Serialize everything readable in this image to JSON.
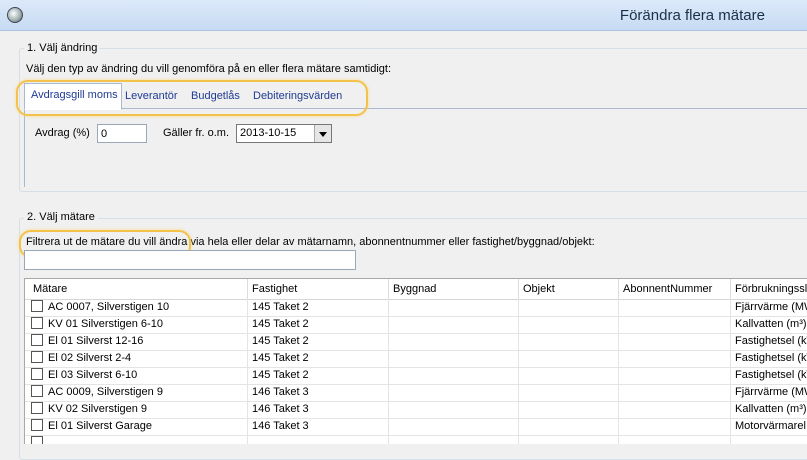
{
  "window": {
    "title": "Förändra flera mätare"
  },
  "section1": {
    "label": "1. Välj ändring",
    "hint": "Välj den typ av ändring du vill genomföra på en eller flera mätare samtidigt:",
    "tabs": [
      "Avdragsgill moms",
      "Leverantör",
      "Budgetlås",
      "Debiteringsvärden"
    ],
    "fields": {
      "avdrag_label": "Avdrag (%)",
      "avdrag_value": "0",
      "galler_label": "Gäller fr. o.m.",
      "galler_value": "2013-10-15"
    }
  },
  "section2": {
    "label": "2. Välj mätare",
    "hint": "Filtrera ut de mätare du vill ändra via hela eller delar av mätarnamn, abonnentnummer eller fastighet/byggnad/objekt:",
    "filter_value": ""
  },
  "grid": {
    "columns": [
      "Mätare",
      "Fastighet",
      "Byggnad",
      "Objekt",
      "AbonnentNummer",
      "Förbrukningsslag"
    ],
    "rows": [
      [
        "AC 0007, Silverstigen 10",
        "145 Taket 2",
        "",
        "",
        "",
        "Fjärrvärme (MWh)"
      ],
      [
        "KV 01 Silverstigen 6-10",
        "145 Taket 2",
        "",
        "",
        "",
        "Kallvatten (m³)"
      ],
      [
        "El 01 Silverst 12-16",
        "145 Taket 2",
        "",
        "",
        "",
        "Fastighetsel (kWh)"
      ],
      [
        "El 02 Silverst 2-4",
        "145 Taket 2",
        "",
        "",
        "",
        "Fastighetsel (kWh)"
      ],
      [
        "El 03 Silverst 6-10",
        "145 Taket 2",
        "",
        "",
        "",
        "Fastighetsel (kWh)"
      ],
      [
        "AC 0009, Silverstigen 9",
        "146 Taket 3",
        "",
        "",
        "",
        "Fjärrvärme (MWh)"
      ],
      [
        "KV 02 Silverstigen 9",
        "146 Taket 3",
        "",
        "",
        "",
        "Kallvatten (m³)"
      ],
      [
        "El 01 Silverst Garage",
        "146 Taket 3",
        "",
        "",
        "",
        "Motorvärmarel (kWh)"
      ],
      [
        "",
        "",
        "",
        "",
        "",
        ""
      ]
    ]
  }
}
